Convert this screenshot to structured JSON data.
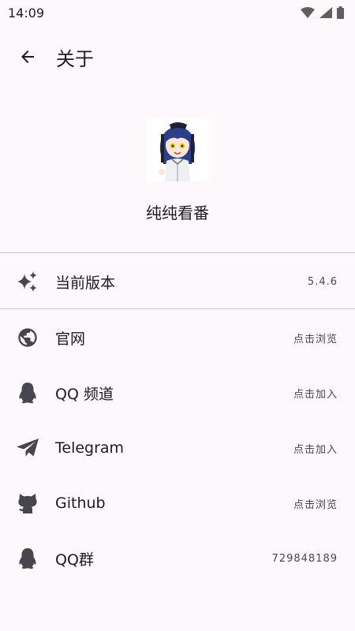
{
  "status_bar": {
    "time": "14:09"
  },
  "app_bar": {
    "title": "关于"
  },
  "app": {
    "name": "纯纯看番"
  },
  "version_row": {
    "label": "当前版本",
    "value": "5.4.6"
  },
  "links": [
    {
      "label": "官网",
      "value": "点击浏览",
      "icon": "globe-icon"
    },
    {
      "label": "QQ 频道",
      "value": "点击加入",
      "icon": "qq-penguin-icon"
    },
    {
      "label": "Telegram",
      "value": "点击加入",
      "icon": "telegram-send-icon"
    },
    {
      "label": "Github",
      "value": "点击浏览",
      "icon": "github-icon"
    },
    {
      "label": "QQ群",
      "value": "729848189",
      "icon": "qq-penguin-icon"
    }
  ],
  "colors": {
    "background": "#fdf8fc",
    "text": "#1c1b1f",
    "icon": "#47464f",
    "divider": "#c9c4cb"
  }
}
